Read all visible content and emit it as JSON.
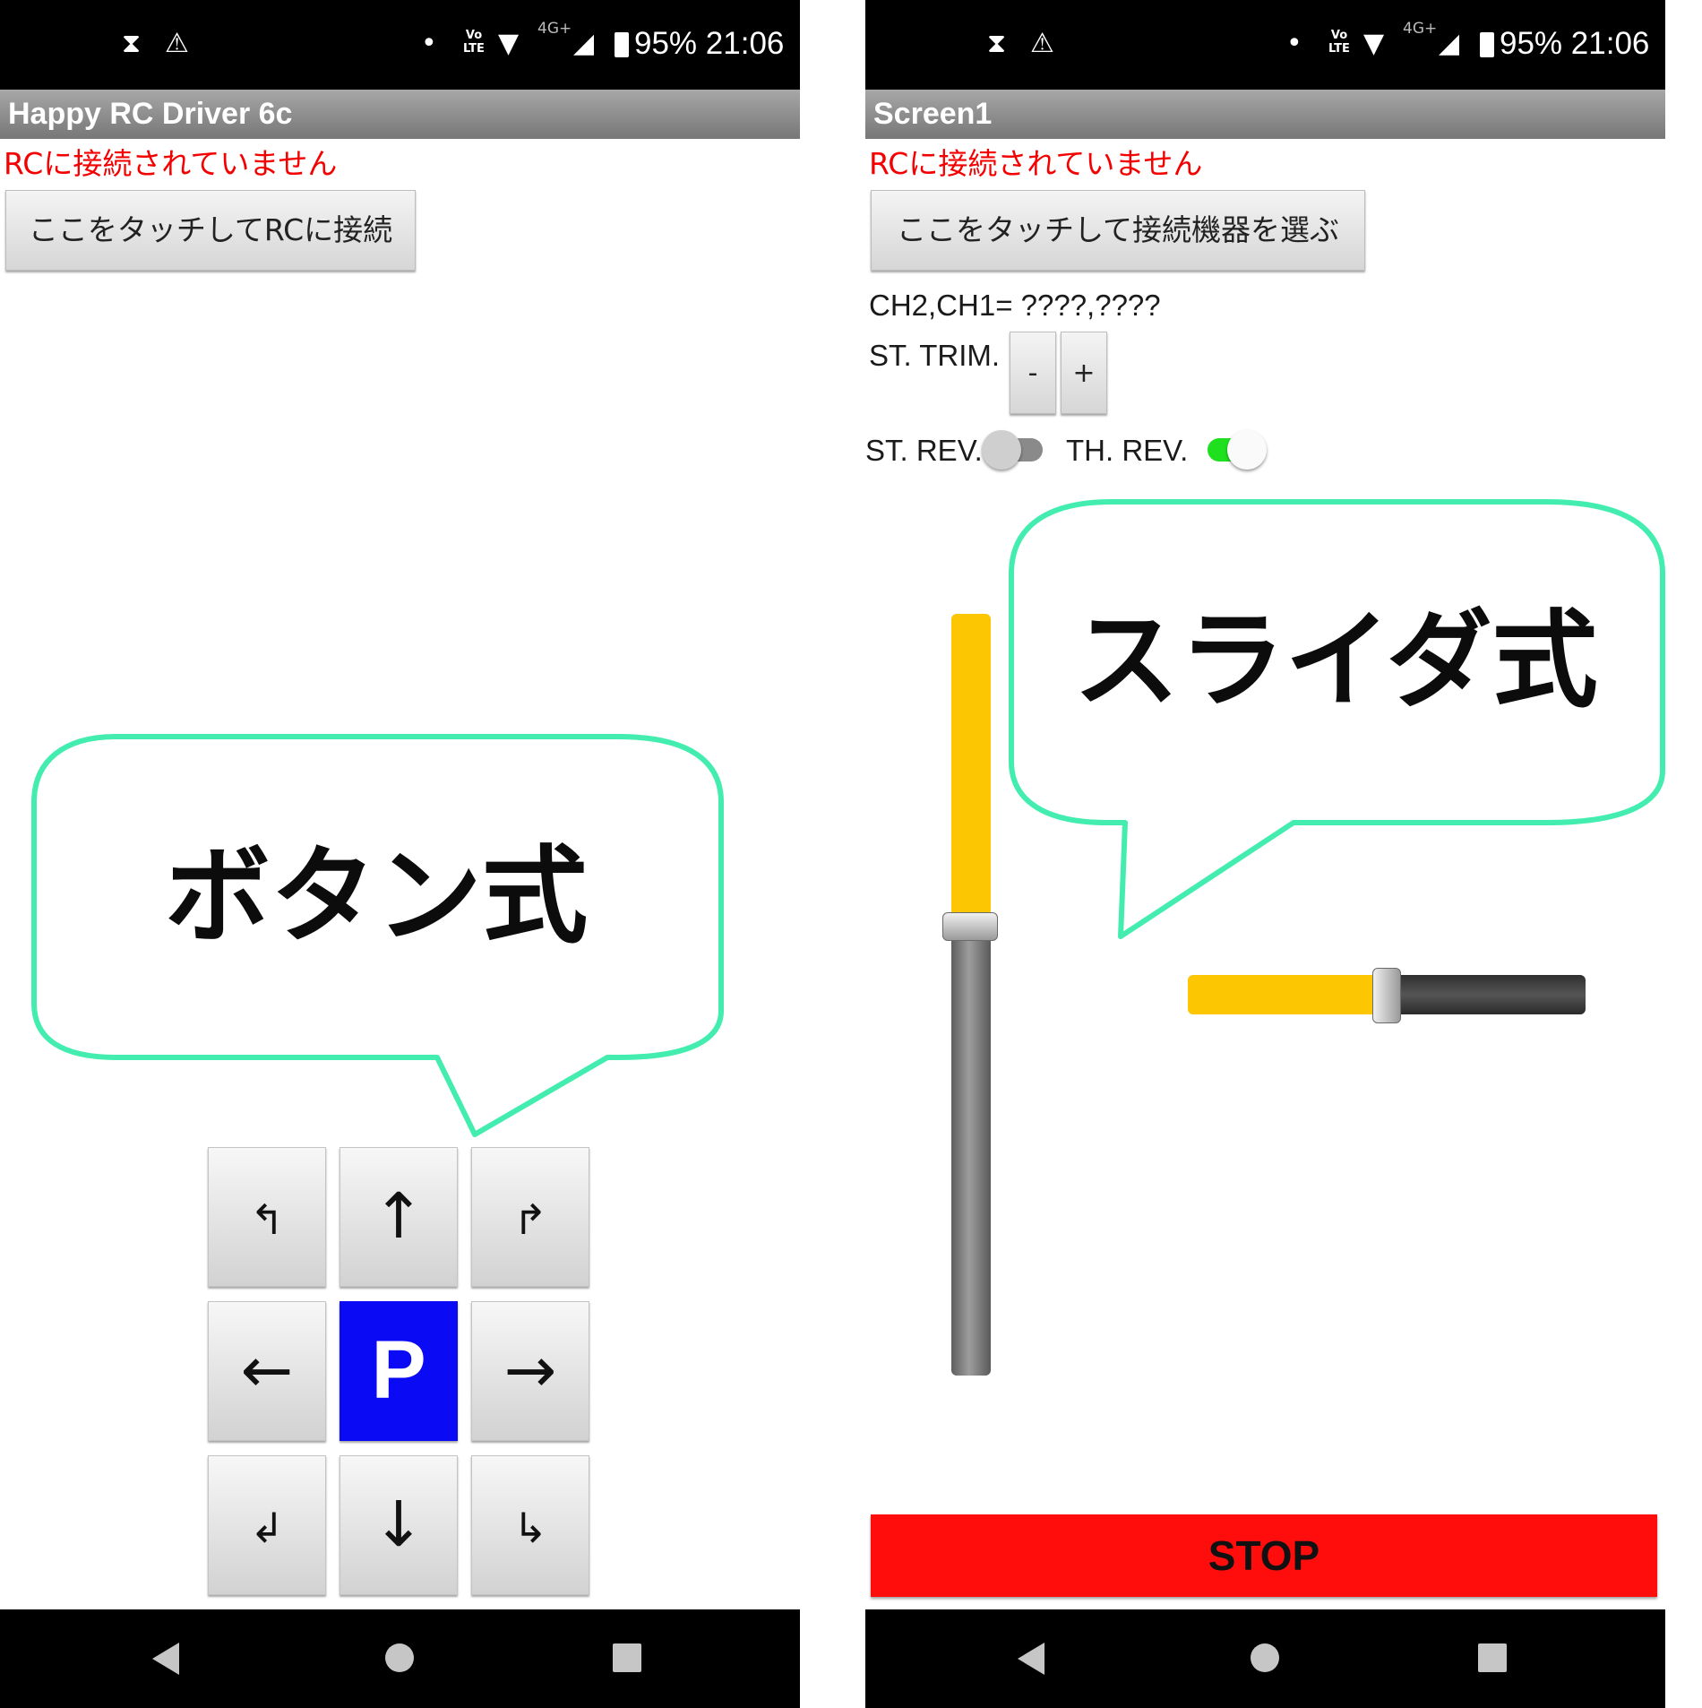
{
  "status_bar": {
    "time": "21:06",
    "battery_text": "95%",
    "network": "4G+",
    "volte": "Vo LTE",
    "icons": [
      "hourglass-icon",
      "warning-icon",
      "notification-dot-icon",
      "volte-icon",
      "wifi-icon",
      "signal-icon",
      "battery-icon"
    ]
  },
  "left_screen": {
    "title": "Happy RC Driver 6c",
    "status_message": "RCに接続されていません",
    "connect_button": "ここをタッチしてRCに接続",
    "bubble_label": "ボタン式",
    "pad": {
      "forward_left": "↰",
      "forward": "↑",
      "forward_right": "↱",
      "left": "←",
      "park": "P",
      "right": "→",
      "back_left": "↲",
      "back": "↓",
      "back_right": "↳"
    }
  },
  "right_screen": {
    "title": "Screen1",
    "status_message": "RCに接続されていません",
    "select_device_button": "ここをタッチして接続機器を選ぶ",
    "channel_readout": "CH2,CH1= ????,????",
    "steering_trim_label": "ST. TRIM.",
    "trim_minus": "-",
    "trim_plus": "+",
    "steering_reverse_label": "ST. REV.",
    "steering_reverse_on": false,
    "throttle_reverse_label": "TH. REV.",
    "throttle_reverse_on": true,
    "throttle_slider_value": 0.5,
    "steering_slider_value": 0.5,
    "bubble_label": "スライダ式",
    "stop_button": "STOP"
  },
  "colors": {
    "status_text": "#f40000",
    "bubble_outline": "#43edb0",
    "slider_fill": "#fcc603",
    "switch_on": "#1fe01f",
    "park_button": "#0a0af5",
    "stop_button": "#ff0d0d"
  },
  "nav_bar": {
    "icons": [
      "back-icon",
      "home-icon",
      "recents-icon"
    ]
  }
}
